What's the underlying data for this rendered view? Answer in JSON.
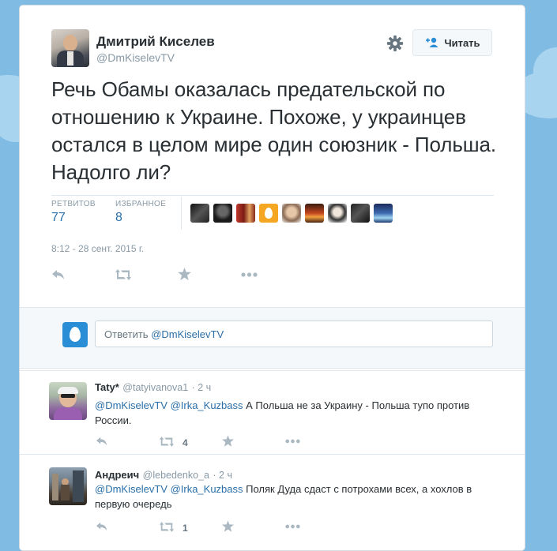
{
  "tweet": {
    "author_name": "Дмитрий Киселев",
    "author_handle": "@DmKiselevTV",
    "follow_label": "Читать",
    "text": "Речь Обамы оказалась предательской по отношению к Украине. Похоже, у украинцев остался в целом мире один союзник - Польша. Надолго ли?",
    "retweets_label": "РЕТВИТОВ",
    "retweets_count": "77",
    "favorites_label": "ИЗБРАННОЕ",
    "favorites_count": "8",
    "timestamp": "8:12 - 28 сент. 2015 г."
  },
  "reply_box": {
    "placeholder_prefix": "Ответить ",
    "placeholder_mention": "@DmKiselevTV"
  },
  "replies": [
    {
      "name": "Taty*",
      "handle": "@tatyivanova1",
      "time": "· 2 ч",
      "mention1": "@DmKiselevTV",
      "mention2": "@Irka_Kuzbass",
      "text": " А Польша не за Украину - Польша тупо против России.",
      "retweet_count": "4"
    },
    {
      "name": "Андреич",
      "handle": "@lebedenko_a",
      "time": "· 2 ч",
      "mention1": "@DmKiselevTV",
      "mention2": "@Irka_Kuzbass",
      "text": " Поляк Дуда сдаст с потрохами всех, а хохлов в первую очередь",
      "retweet_count": "1"
    }
  ],
  "colors": {
    "link": "#2a6fa8",
    "muted": "#8899a6",
    "background": "#7fbbe3",
    "egg_avatar": "#2a8ed6"
  },
  "icons": [
    "gear-icon",
    "follow-person-icon",
    "reply-icon",
    "retweet-icon",
    "favorite-icon",
    "more-icon"
  ]
}
